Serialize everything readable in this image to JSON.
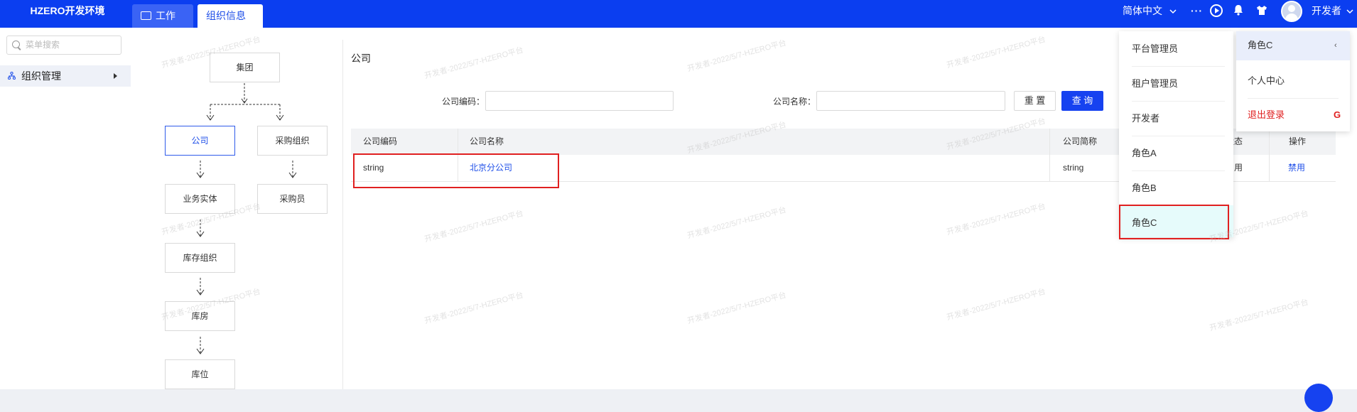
{
  "app": {
    "title": "HZERO开发环境"
  },
  "tabs": [
    {
      "label": "工作台",
      "icon": "monitor-icon"
    },
    {
      "label": "组织信息",
      "close": "×"
    }
  ],
  "topbar": {
    "language": "简体中文",
    "more": "···",
    "username": "开发者"
  },
  "sidebar": {
    "search_placeholder": "菜单搜索",
    "items": [
      {
        "label": "组织管理",
        "icon": "org-tree-icon"
      }
    ]
  },
  "tree": {
    "nodes": [
      "集团",
      "公司",
      "采购组织",
      "业务实体",
      "采购员",
      "库存组织",
      "库房",
      "库位"
    ]
  },
  "section": {
    "title": "公司"
  },
  "filters": {
    "code_label": "公司编码：",
    "name_label": "公司名称：",
    "code_value": "",
    "name_value": "",
    "reset_label": "重 置",
    "query_label": "查 询"
  },
  "table": {
    "headers": [
      "公司编码",
      "公司名称",
      "公司简称",
      "状态",
      "操作"
    ],
    "rows": [
      {
        "code": "string",
        "name": "北京分公司",
        "short_name": "string",
        "status": "启用",
        "action": "禁用"
      }
    ]
  },
  "role_menu": {
    "items": [
      "平台管理员",
      "租户管理员",
      "开发者",
      "角色A",
      "角色B",
      "角色C"
    ],
    "selected": "角色C"
  },
  "user_menu": {
    "current_role": "角色C",
    "collapse": "‹",
    "profile": "个人中心",
    "logout": "退出登录",
    "logout_icon": "G"
  },
  "watermark": "开发者-2022/5/7-HZERO平台",
  "colors": {
    "primary": "#1642f0",
    "topbar": "#0b3ef0",
    "danger": "#e02020"
  }
}
